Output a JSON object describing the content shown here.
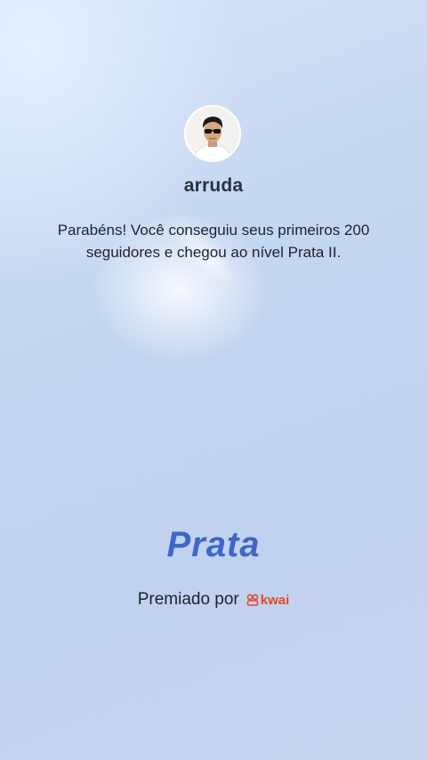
{
  "profile": {
    "username": "arruda",
    "avatar_icon": "user-avatar-photo"
  },
  "message": {
    "text": "Parabéns! Você conseguiu seus primeiros 200 seguidores e chegou ao nível Prata II."
  },
  "level": {
    "title": "Prata",
    "color": "#3f66c6"
  },
  "awarded": {
    "label": "Premiado por",
    "brand_name": "kwai",
    "brand_icon": "kwai-logo-icon",
    "brand_color": "#e04a2a"
  }
}
